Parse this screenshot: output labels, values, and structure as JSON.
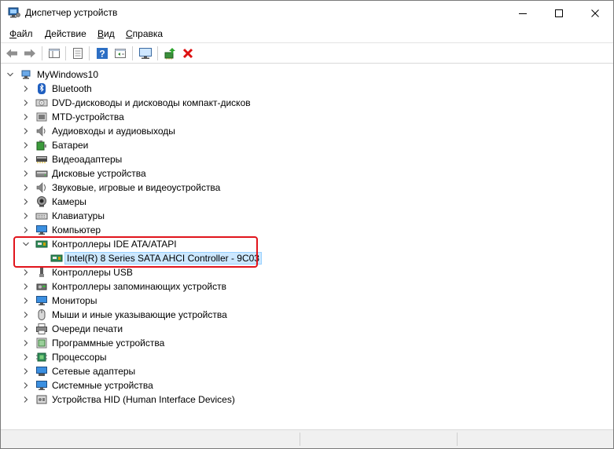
{
  "window": {
    "title": "Диспетчер устройств"
  },
  "menu": {
    "items": [
      {
        "label": "Файл",
        "underline": "Ф",
        "rest": "айл"
      },
      {
        "label": "Действие",
        "underline": "Д",
        "rest": "ействие"
      },
      {
        "label": "Вид",
        "underline": "В",
        "rest": "ид"
      },
      {
        "label": "Справка",
        "underline": "С",
        "rest": "правка"
      }
    ]
  },
  "toolbar": {
    "icons": [
      "back-icon",
      "forward-icon",
      "properties-pane-icon",
      "show-hide-console-tree-icon",
      "help-icon",
      "action-pane-icon",
      "scan-hardware-icon",
      "update-driver-icon",
      "uninstall-icon"
    ]
  },
  "tree": {
    "root": "MyWindows10",
    "categories": [
      {
        "label": "Bluetooth",
        "icon": "bluetooth-icon"
      },
      {
        "label": "DVD-дисководы и дисководы компакт-дисков",
        "icon": "dvd-drive-icon"
      },
      {
        "label": "MTD-устройства",
        "icon": "mtd-device-icon"
      },
      {
        "label": "Аудиовходы и аудиовыходы",
        "icon": "audio-io-icon"
      },
      {
        "label": "Батареи",
        "icon": "battery-icon"
      },
      {
        "label": "Видеоадаптеры",
        "icon": "display-adapter-icon"
      },
      {
        "label": "Дисковые устройства",
        "icon": "disk-drive-icon"
      },
      {
        "label": "Звуковые, игровые и видеоустройства",
        "icon": "sound-device-icon"
      },
      {
        "label": "Камеры",
        "icon": "camera-icon"
      },
      {
        "label": "Клавиатуры",
        "icon": "keyboard-icon"
      },
      {
        "label": "Компьютер",
        "icon": "computer-icon"
      },
      {
        "label": "Контроллеры IDE ATA/ATAPI",
        "icon": "ide-controller-icon",
        "expanded": true
      },
      {
        "label": "Контроллеры USB",
        "icon": "usb-controller-icon"
      },
      {
        "label": "Контроллеры запоминающих устройств",
        "icon": "storage-controller-icon"
      },
      {
        "label": "Мониторы",
        "icon": "monitor-icon"
      },
      {
        "label": "Мыши и иные указывающие устройства",
        "icon": "mouse-icon"
      },
      {
        "label": "Очереди печати",
        "icon": "print-queue-icon"
      },
      {
        "label": "Программные устройства",
        "icon": "software-device-icon"
      },
      {
        "label": "Процессоры",
        "icon": "processor-icon"
      },
      {
        "label": "Сетевые адаптеры",
        "icon": "network-adapter-icon"
      },
      {
        "label": "Системные устройства",
        "icon": "system-device-icon"
      },
      {
        "label": "Устройства HID (Human Interface Devices)",
        "icon": "hid-device-icon"
      }
    ],
    "expanded_child": {
      "label": "Intel(R) 8 Series SATA AHCI Controller - 9C03",
      "icon": "ide-controller-icon"
    }
  },
  "colors": {
    "highlight_box": "#e1141c",
    "selection_bg": "#cce8ff",
    "selection_border": "#99d1ff"
  }
}
